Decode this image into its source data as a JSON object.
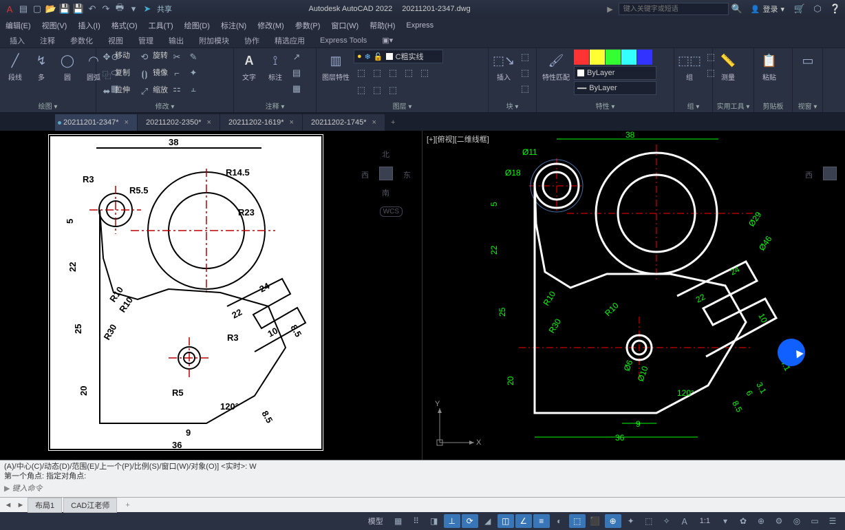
{
  "titlebar": {
    "app": "Autodesk AutoCAD 2022",
    "file": "20211201-2347.dwg",
    "share": "共享",
    "search_placeholder": "键入关键字或短语",
    "login": "登录"
  },
  "menubar": [
    "编辑(E)",
    "视图(V)",
    "插入(I)",
    "格式(O)",
    "工具(T)",
    "绘图(D)",
    "标注(N)",
    "修改(M)",
    "参数(P)",
    "窗口(W)",
    "帮助(H)",
    "Express"
  ],
  "ribbon_tabs": [
    "插入",
    "注释",
    "参数化",
    "视图",
    "管理",
    "输出",
    "附加模块",
    "协作",
    "精选应用",
    "Express Tools"
  ],
  "ribbon": {
    "draw": {
      "label": "绘图 ▾",
      "line": "段线",
      "poly": "多",
      "circle": "圆",
      "arc": "圆弧"
    },
    "modify": {
      "label": "修改 ▾",
      "move": "移动",
      "rotate": "旋转",
      "copy": "复制",
      "mirror": "镜像",
      "stretch": "拉伸",
      "scale": "缩放"
    },
    "annot": {
      "label": "注释 ▾",
      "text": "文字",
      "dim": "标注"
    },
    "layer": {
      "label": "图层 ▾",
      "props": "图层特性",
      "current": "C粗实线"
    },
    "block": {
      "label": "块 ▾",
      "insert": "插入"
    },
    "props": {
      "label": "特性 ▾",
      "match": "特性匹配",
      "bylayer1": "ByLayer",
      "bylayer2": "ByLayer"
    },
    "group": {
      "label": "组 ▾",
      "group": "组"
    },
    "util": {
      "label": "实用工具 ▾",
      "measure": "测量"
    },
    "clip": {
      "label": "剪贴板",
      "paste": "粘贴"
    },
    "view": {
      "label": "视窗 ▾"
    }
  },
  "doc_tabs": [
    {
      "name": "20211201-2347*",
      "active": true
    },
    {
      "name": "20211202-2350*",
      "active": false
    },
    {
      "name": "20211202-1619*",
      "active": false
    },
    {
      "name": "20211202-1745*",
      "active": false
    }
  ],
  "right_view_label": "[+][俯视][二维线框]",
  "compass": {
    "n": "北",
    "s": "南",
    "e": "东",
    "w": "西"
  },
  "wcs": "WCS",
  "axes": {
    "x": "X",
    "y": "Y"
  },
  "dimensions_left": {
    "d38": "38",
    "r145": "R14.5",
    "r23": "R23",
    "r55": "R5.5",
    "r3": "R3",
    "d5": "5",
    "d22": "22",
    "d25": "25",
    "r10": "R10",
    "r30": "R30",
    "d24": "24",
    "d22b": "22",
    "r3b": "R3",
    "d10": "10",
    "d85": "8.5",
    "d120": "120°",
    "d85b": "8.5",
    "d20": "20",
    "d9": "9",
    "d36": "36",
    "r5": "R5"
  },
  "dimensions_right": {
    "d38": "38",
    "phi11": "Ø11",
    "phi18": "Ø18",
    "d5": "5",
    "d22": "22",
    "d25": "25",
    "r10": "R10",
    "r30": "R30",
    "r10b": "R10",
    "d20": "20",
    "phi29": "Ø29",
    "phi46": "Ø46",
    "d24": "24",
    "d22b": "22",
    "d10": "10",
    "phi6": "Ø6",
    "phi10": "Ø10",
    "d120": "120°",
    "d85": "8.5",
    "d31": "3.1",
    "d41": "4.1",
    "d6": "6",
    "d9": "9",
    "d36": "36"
  },
  "cmdline": {
    "l1": "(A)/中心(C)/动态(D)/范围(E)/上一个(P)/比例(S)/窗口(W)/对象(O)] <实时>: W",
    "l2": "第一个角点: 指定对角点:",
    "prompt": "键入命令"
  },
  "layout_tabs": [
    "布局1",
    "CAD江老师"
  ],
  "status": {
    "model": "模型",
    "scale": "1:1"
  }
}
